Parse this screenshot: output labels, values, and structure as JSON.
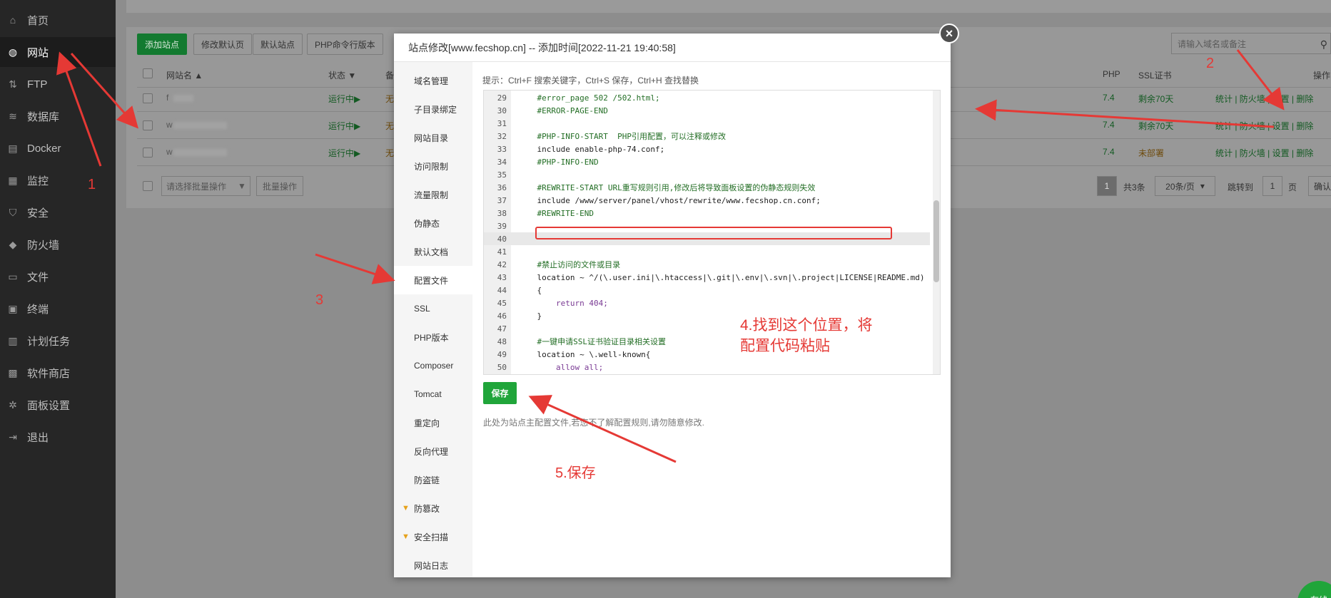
{
  "sidebar": {
    "items": [
      {
        "label": "首页",
        "icon": "home-icon"
      },
      {
        "label": "网站",
        "icon": "globe-icon",
        "active": true
      },
      {
        "label": "FTP",
        "icon": "ftp-icon"
      },
      {
        "label": "数据库",
        "icon": "database-icon"
      },
      {
        "label": "Docker",
        "icon": "docker-icon"
      },
      {
        "label": "监控",
        "icon": "monitor-icon"
      },
      {
        "label": "安全",
        "icon": "shield-icon"
      },
      {
        "label": "防火墙",
        "icon": "firewall-icon"
      },
      {
        "label": "文件",
        "icon": "folder-icon"
      },
      {
        "label": "终端",
        "icon": "terminal-icon"
      },
      {
        "label": "计划任务",
        "icon": "calendar-icon"
      },
      {
        "label": "软件商店",
        "icon": "apps-icon"
      },
      {
        "label": "面板设置",
        "icon": "gear-icon"
      },
      {
        "label": "退出",
        "icon": "logout-icon"
      }
    ]
  },
  "toolbar": {
    "buttons": [
      "添加站点",
      "修改默认页",
      "默认站点",
      "PHP命令行版本"
    ],
    "search_placeholder": "请输入域名或备注"
  },
  "table": {
    "headers": {
      "name": "网站名 ▲",
      "status": "状态 ▼",
      "remark": "备",
      "php": "PHP",
      "ssl": "SSL证书",
      "ops": "操作"
    },
    "rows": [
      {
        "name": "f",
        "status": "运行中▶",
        "remark": "无",
        "php": "7.4",
        "ssl": "剩余70天",
        "ssl_state": "ok"
      },
      {
        "name": "w",
        "status": "运行中▶",
        "remark": "无",
        "php": "7.4",
        "ssl": "剩余70天",
        "ssl_state": "ok"
      },
      {
        "name": "w",
        "status": "运行中▶",
        "remark": "无",
        "php": "7.4",
        "ssl": "未部署",
        "ssl_state": "none"
      }
    ],
    "row_ops": "统计 | 防火墙 | 设置 | 删除",
    "batch_select": "请选择批量操作",
    "batch_button": "批量操作"
  },
  "pager": {
    "current": "1",
    "total": "共3条",
    "per_page": "20条/页",
    "jump_label": "跳转到",
    "jump_value": "1",
    "page_unit": "页",
    "confirm": "确认"
  },
  "modal": {
    "title": "站点修改[www.fecshop.cn] -- 添加时间[2022-11-21 19:40:58]",
    "close": "×",
    "menu": [
      {
        "label": "域名管理"
      },
      {
        "label": "子目录绑定"
      },
      {
        "label": "网站目录"
      },
      {
        "label": "访问限制"
      },
      {
        "label": "流量限制"
      },
      {
        "label": "伪静态"
      },
      {
        "label": "默认文档"
      },
      {
        "label": "配置文件",
        "active": true
      },
      {
        "label": "SSL"
      },
      {
        "label": "PHP版本"
      },
      {
        "label": "Composer"
      },
      {
        "label": "Tomcat"
      },
      {
        "label": "重定向"
      },
      {
        "label": "反向代理"
      },
      {
        "label": "防盗链"
      },
      {
        "label": "防篡改",
        "gem": true
      },
      {
        "label": "安全扫描",
        "gem": true
      },
      {
        "label": "网站日志"
      }
    ],
    "hint": "提示：Ctrl+F 搜索关键字，Ctrl+S 保存，Ctrl+H 查找替换",
    "code_lines": [
      {
        "n": "29",
        "text": "    #error_page 502 /502.html;",
        "cls": "c-comment"
      },
      {
        "n": "30",
        "text": "    #ERROR-PAGE-END",
        "cls": "c-comment"
      },
      {
        "n": "31",
        "text": "",
        "cls": "c-default"
      },
      {
        "n": "32",
        "text": "    #PHP-INFO-START  PHP引用配置，可以注释或修改",
        "cls": "c-comment"
      },
      {
        "n": "33",
        "text": "    include enable-php-74.conf;",
        "cls": "c-default"
      },
      {
        "n": "34",
        "text": "    #PHP-INFO-END",
        "cls": "c-comment"
      },
      {
        "n": "35",
        "text": "",
        "cls": "c-default"
      },
      {
        "n": "36",
        "text": "    #REWRITE-START URL重写规则引用,修改后将导致面板设置的伪静态规则失效",
        "cls": "c-comment"
      },
      {
        "n": "37",
        "text": "    include /www/server/panel/vhost/rewrite/www.fecshop.cn.conf;",
        "cls": "c-default"
      },
      {
        "n": "38",
        "text": "    #REWRITE-END",
        "cls": "c-comment"
      },
      {
        "n": "39",
        "text": "",
        "cls": "c-default"
      },
      {
        "n": "40",
        "text": "",
        "cls": "c-default",
        "hl": true
      },
      {
        "n": "41",
        "text": "",
        "cls": "c-default"
      },
      {
        "n": "42",
        "text": "    #禁止访问的文件或目录",
        "cls": "c-comment"
      },
      {
        "n": "43",
        "text": "    location ~ ^/(\\.user.ini|\\.htaccess|\\.git|\\.env|\\.svn|\\.project|LICENSE|README.md)",
        "cls": "c-default"
      },
      {
        "n": "44",
        "text": "    {",
        "cls": "c-default"
      },
      {
        "n": "45",
        "text": "        return 404;",
        "cls": "c-kw"
      },
      {
        "n": "46",
        "text": "    }",
        "cls": "c-default"
      },
      {
        "n": "47",
        "text": "",
        "cls": "c-default"
      },
      {
        "n": "48",
        "text": "    #一键申请SSL证书验证目录相关设置",
        "cls": "c-comment"
      },
      {
        "n": "49",
        "text": "    location ~ \\.well-known{",
        "cls": "c-default"
      },
      {
        "n": "50",
        "text": "        allow all;",
        "cls": "c-kw"
      }
    ],
    "save": "保存",
    "note": "此处为站点主配置文件,若您不了解配置规则,请勿随意修改."
  },
  "annotations": {
    "n1": "1",
    "n2": "2",
    "n3": "3",
    "n4": "4.找到这个位置，将\n配置代码粘贴",
    "n5": "5.保存",
    "color": "#e53935"
  },
  "badge": "在线"
}
